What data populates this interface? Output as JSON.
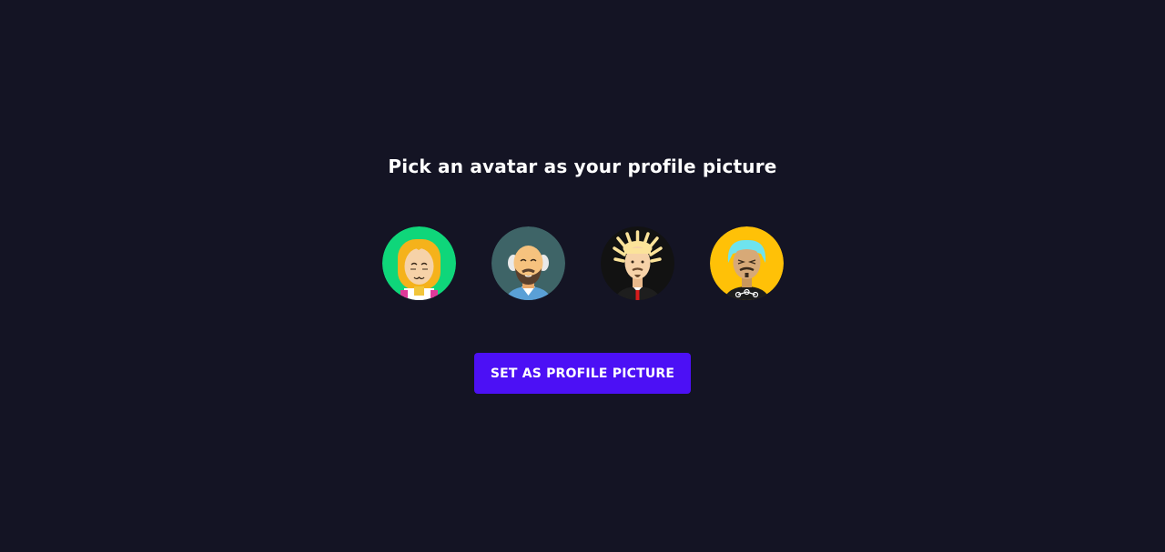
{
  "title": "Pick an avatar as your profile picture",
  "avatars": [
    {
      "name": "avatar-blonde-woman",
      "bg": "#0fd67a"
    },
    {
      "name": "avatar-bald-bearded-man",
      "bg": "#3e6467"
    },
    {
      "name": "avatar-spiky-hair-man",
      "bg": "#121212"
    },
    {
      "name": "avatar-cyan-hair-man",
      "bg": "#ffc107"
    }
  ],
  "cta": {
    "label": "SET AS PROFILE PICTURE",
    "color": "#4c10f5"
  },
  "colors": {
    "background": "#141424",
    "text": "#ffffff"
  }
}
